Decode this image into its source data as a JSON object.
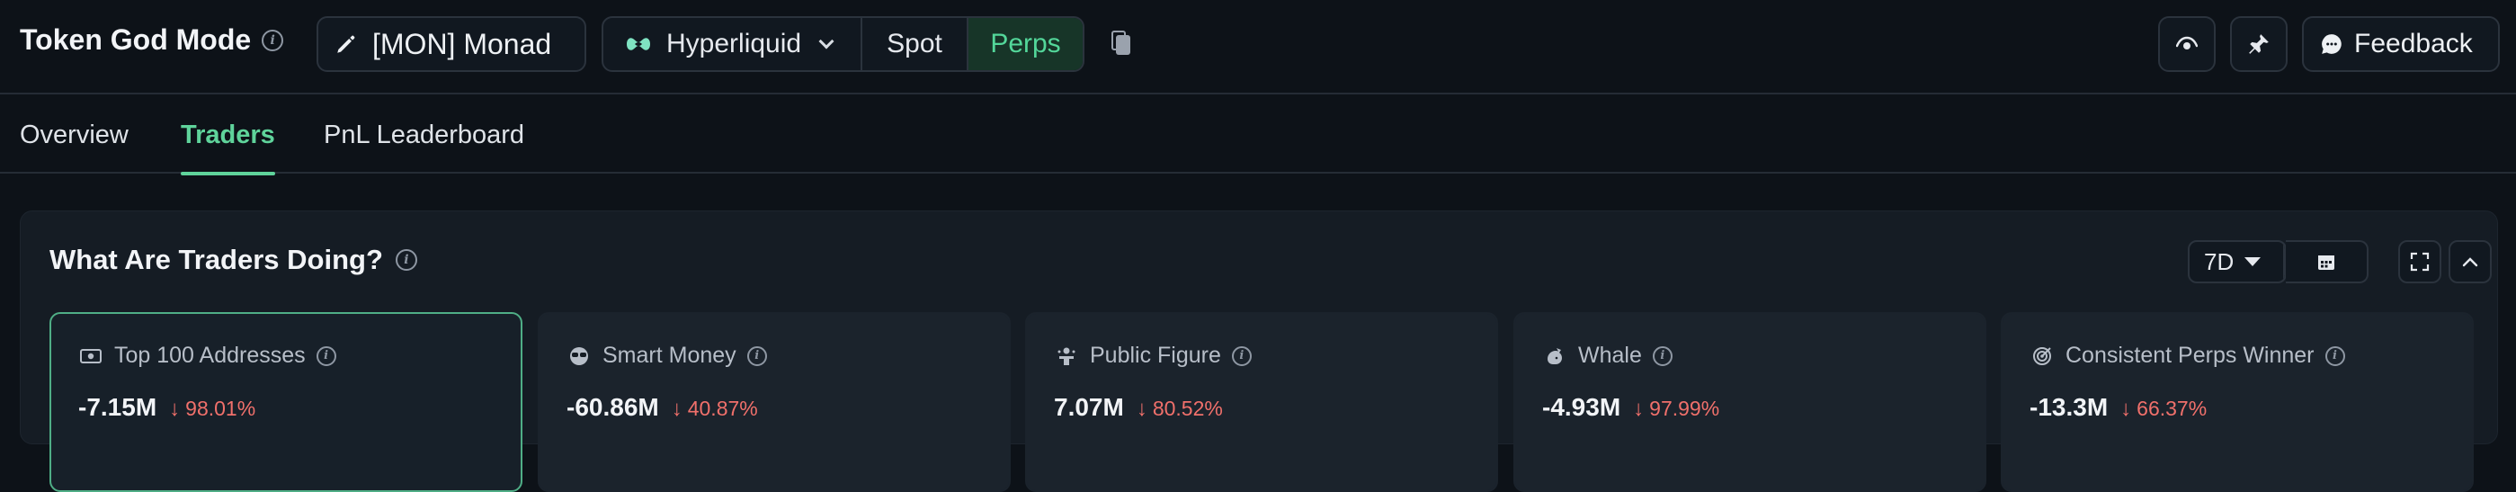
{
  "header": {
    "title": "Token God Mode",
    "token_label": "[MON] Monad",
    "network": {
      "selected": "Hyperliquid",
      "options": [
        "Spot",
        "Perps"
      ],
      "active": "Perps"
    },
    "feedback_label": "Feedback"
  },
  "tabs": [
    {
      "label": "Overview"
    },
    {
      "label": "Traders",
      "active": true
    },
    {
      "label": "PnL Leaderboard"
    }
  ],
  "panel": {
    "title": "What Are Traders Doing?",
    "range": "7D",
    "cards": [
      {
        "label": "Top 100 Addresses",
        "value": "-7.15M",
        "change": "98.01%",
        "icon": "money-icon",
        "active": true
      },
      {
        "label": "Smart Money",
        "value": "-60.86M",
        "change": "40.87%",
        "icon": "sunglasses-icon"
      },
      {
        "label": "Public Figure",
        "value": "7.07M",
        "change": "80.52%",
        "icon": "podium-icon"
      },
      {
        "label": "Whale",
        "value": "-4.93M",
        "change": "97.99%",
        "icon": "whale-icon"
      },
      {
        "label": "Consistent Perps Winner",
        "value": "-13.3M",
        "change": "66.37%",
        "icon": "target-icon"
      }
    ]
  },
  "colors": {
    "accent": "#5fd39b",
    "negative": "#f0706b",
    "background": "#0d1218"
  }
}
